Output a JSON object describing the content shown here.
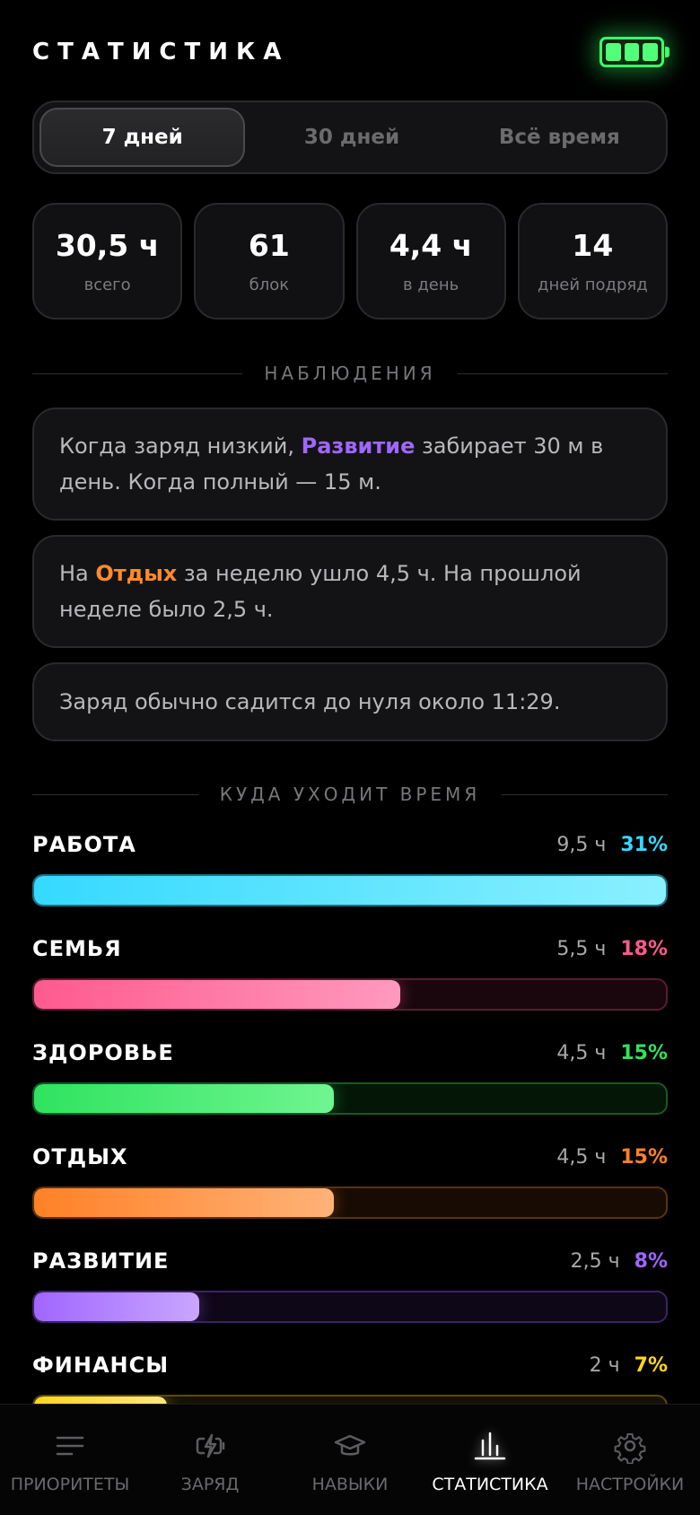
{
  "header": {
    "title": "СТАТИСТИКА",
    "battery_icon": "battery-full-icon",
    "battery_color": "#3dff6a"
  },
  "period_tabs": [
    {
      "label": "7 дней",
      "active": true
    },
    {
      "label": "30 дней",
      "active": false
    },
    {
      "label": "Всё время",
      "active": false
    }
  ],
  "summary": [
    {
      "value": "30,5 ч",
      "label": "всего"
    },
    {
      "value": "61",
      "label": "блок"
    },
    {
      "value": "4,4 ч",
      "label": "в день"
    },
    {
      "value": "14",
      "label": "дней подряд"
    }
  ],
  "observations": {
    "title": "НАБЛЮДЕНИЯ",
    "items": [
      {
        "pre": "Когда заряд низкий, ",
        "highlight": "Развитие",
        "highlight_color": "#a066ff",
        "post": " забирает 30 м в день. Когда полный — 15 м."
      },
      {
        "pre": "На ",
        "highlight": "Отдых",
        "highlight_color": "#ff8a2a",
        "post": " за неделю ушло 4,5 ч. На прошлой неделе было 2,5 ч."
      },
      {
        "pre": "Заряд обычно садится до нуля около 11:29.",
        "highlight": "",
        "highlight_color": "",
        "post": ""
      }
    ]
  },
  "time_section": {
    "title": "КУДА УХОДИТ ВРЕМЯ",
    "categories": [
      {
        "name": "РАБОТА",
        "hours": "9,5 ч",
        "percent": "31%",
        "fraction": 1.0,
        "color": "#35d9ff",
        "color_light": "#8af0ff",
        "track": "#0b2a33",
        "border": "#1f6f86"
      },
      {
        "name": "СЕМЬЯ",
        "hours": "5,5 ч",
        "percent": "18%",
        "fraction": 0.58,
        "color": "#ff5a8f",
        "color_light": "#ff99bd",
        "track": "#1a070d",
        "border": "#5a1d30"
      },
      {
        "name": "ЗДОРОВЬЕ",
        "hours": "4,5 ч",
        "percent": "15%",
        "fraction": 0.475,
        "color": "#2fe35f",
        "color_light": "#6ff590",
        "track": "#041606",
        "border": "#165a25"
      },
      {
        "name": "ОТДЫХ",
        "hours": "4,5 ч",
        "percent": "15%",
        "fraction": 0.475,
        "color": "#ff8126",
        "color_light": "#ffb278",
        "track": "#170b03",
        "border": "#5c3112"
      },
      {
        "name": "РАЗВИТИЕ",
        "hours": "2,5 ч",
        "percent": "8%",
        "fraction": 0.262,
        "color": "#a066ff",
        "color_light": "#c9a6ff",
        "track": "#0e0718",
        "border": "#3c2366"
      },
      {
        "name": "ФИНАНСЫ",
        "hours": "2 ч",
        "percent": "7%",
        "fraction": 0.21,
        "color": "#ffd51f",
        "color_light": "#ffe77a",
        "track": "#161203",
        "border": "#5a4a10"
      }
    ]
  },
  "nav": [
    {
      "label": "ПРИОРИТЕТЫ",
      "icon": "list-icon",
      "active": false
    },
    {
      "label": "ЗАРЯД",
      "icon": "charge-icon",
      "active": false
    },
    {
      "label": "НАВЫКИ",
      "icon": "graduation-cap-icon",
      "active": false
    },
    {
      "label": "СТАТИСТИКА",
      "icon": "bar-chart-icon",
      "active": true
    },
    {
      "label": "НАСТРОЙКИ",
      "icon": "gear-icon",
      "active": false
    }
  ]
}
